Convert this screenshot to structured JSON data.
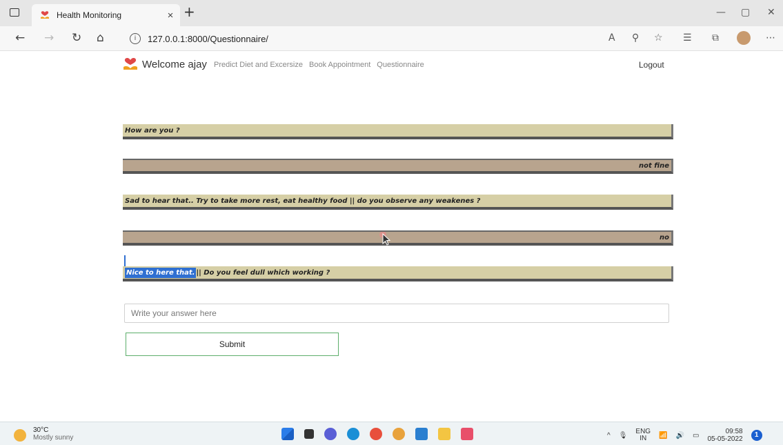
{
  "browser": {
    "tab_title": "Health Monitoring",
    "tab_close": "×",
    "new_tab": "+",
    "url": "127.0.0.1:8000/Questionnaire/",
    "window_controls": [
      "—",
      "▢",
      "✕"
    ]
  },
  "header": {
    "welcome": "Welcome ajay",
    "nav_links": [
      "Predict Diet and Excersize",
      "Book Appointment",
      "Questionnaire"
    ],
    "logout": "Logout"
  },
  "chat": [
    {
      "role": "question",
      "text": "How are you ?"
    },
    {
      "role": "answer",
      "text": "not fine"
    },
    {
      "role": "question",
      "text": "Sad to hear that.. Try to take more rest, eat healthy food || do you observe any weakenes ?"
    },
    {
      "role": "answer",
      "text": "no"
    },
    {
      "role": "question",
      "highlight": "Nice to here that.",
      "text": " || Do you feel dull which working ?"
    }
  ],
  "form": {
    "answer_placeholder": "Write your answer here",
    "submit_label": "Submit"
  },
  "taskbar": {
    "temperature": "30°C",
    "weather": "Mostly sunny",
    "lang_top": "ENG",
    "lang_bottom": "IN",
    "time": "09:58",
    "date": "05-05-2022",
    "notifications": "1"
  }
}
